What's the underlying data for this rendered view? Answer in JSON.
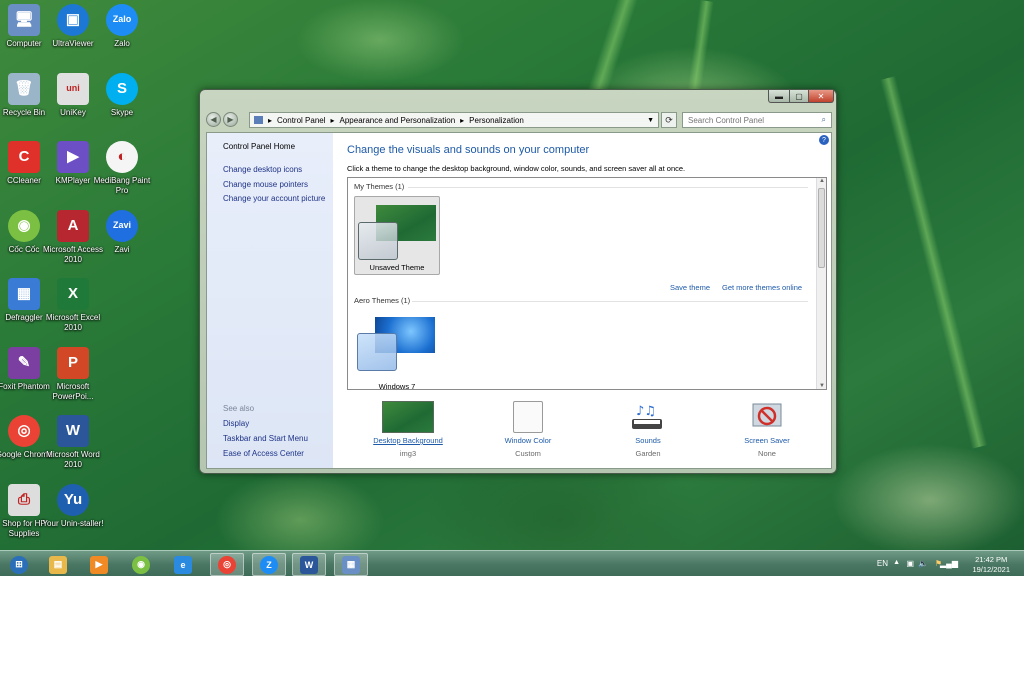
{
  "desktop": {
    "icons": [
      {
        "label": "Computer",
        "icon": "computer-icon",
        "color": "#6a8fc4"
      },
      {
        "label": "UltraViewer",
        "icon": "ultraviewer-icon",
        "color": "#1c78d4"
      },
      {
        "label": "Zalo",
        "icon": "zalo-icon",
        "color": "#1d8df5"
      },
      {
        "label": "Recycle Bin",
        "icon": "recycle-bin-icon",
        "color": "#9ab4c8"
      },
      {
        "label": "UniKey",
        "icon": "unikey-icon",
        "color": "#e0e0e0"
      },
      {
        "label": "Skype",
        "icon": "skype-icon",
        "color": "#00aff0"
      },
      {
        "label": "CCleaner",
        "icon": "ccleaner-icon",
        "color": "#e0302a"
      },
      {
        "label": "KMPlayer",
        "icon": "kmplayer-icon",
        "color": "#6c4fc4"
      },
      {
        "label": "MediBang Paint Pro",
        "icon": "medibang-icon",
        "color": "#f5f5f5"
      },
      {
        "label": "Cốc Cốc",
        "icon": "coccoc-icon",
        "color": "#7bc043"
      },
      {
        "label": "Microsoft Access 2010",
        "icon": "access-icon",
        "color": "#b7272f"
      },
      {
        "label": "Zavi",
        "icon": "zavi-icon",
        "color": "#1f6fe0"
      },
      {
        "label": "Defraggler",
        "icon": "defraggler-icon",
        "color": "#3a7bd5"
      },
      {
        "label": "Microsoft Excel 2010",
        "icon": "excel-icon",
        "color": "#1f7a3a"
      },
      {
        "label": "Foxit Phantom",
        "icon": "foxit-icon",
        "color": "#7a3fa0"
      },
      {
        "label": "Microsoft PowerPoi...",
        "icon": "powerpoint-icon",
        "color": "#d24726"
      },
      {
        "label": "Google Chrome",
        "icon": "chrome-icon",
        "color": "#ea4335"
      },
      {
        "label": "Microsoft Word 2010",
        "icon": "word-icon",
        "color": "#2b579a"
      },
      {
        "label": "Shop for HP Supplies",
        "icon": "printer-icon",
        "color": "#dddddd"
      },
      {
        "label": "Your Unin-staller!",
        "icon": "uninstaller-icon",
        "color": "#1f5fb0"
      }
    ]
  },
  "window": {
    "address": {
      "segments": [
        "Control Panel",
        "Appearance and Personalization",
        "Personalization"
      ]
    },
    "search_placeholder": "Search Control Panel",
    "left_pane": {
      "home": "Control Panel Home",
      "links": [
        "Change desktop icons",
        "Change mouse pointers",
        "Change your account picture"
      ],
      "see_also_title": "See also",
      "see_also": [
        "Display",
        "Taskbar and Start Menu",
        "Ease of Access Center"
      ]
    },
    "main": {
      "title": "Change the visuals and sounds on your computer",
      "subtitle": "Click a theme to change the desktop background, window color, sounds, and screen saver all at once.",
      "my_themes_header": "My Themes (1)",
      "unsaved_theme": "Unsaved Theme",
      "save_theme": "Save theme",
      "get_more": "Get more themes online",
      "aero_header": "Aero Themes (1)",
      "windows7": "Windows 7"
    },
    "bottom": [
      {
        "name": "Desktop Background",
        "value": "img3",
        "icon": "desktop-background-icon"
      },
      {
        "name": "Window Color",
        "value": "Custom",
        "icon": "window-color-icon"
      },
      {
        "name": "Sounds",
        "value": "Garden",
        "icon": "sounds-icon"
      },
      {
        "name": "Screen Saver",
        "value": "None",
        "icon": "screen-saver-icon"
      }
    ]
  },
  "taskbar": {
    "items": [
      "start-orb-icon",
      "explorer-icon",
      "media-player-icon",
      "coccoc-icon",
      "internet-explorer-icon",
      "chrome-icon",
      "zalo-icon",
      "word-icon",
      "control-panel-icon"
    ],
    "lang": "EN",
    "time": "21:42 PM",
    "date": "19/12/2021"
  },
  "colors": {
    "accent_link": "#1e5aa8",
    "left_pane": "#e3eaf8"
  }
}
